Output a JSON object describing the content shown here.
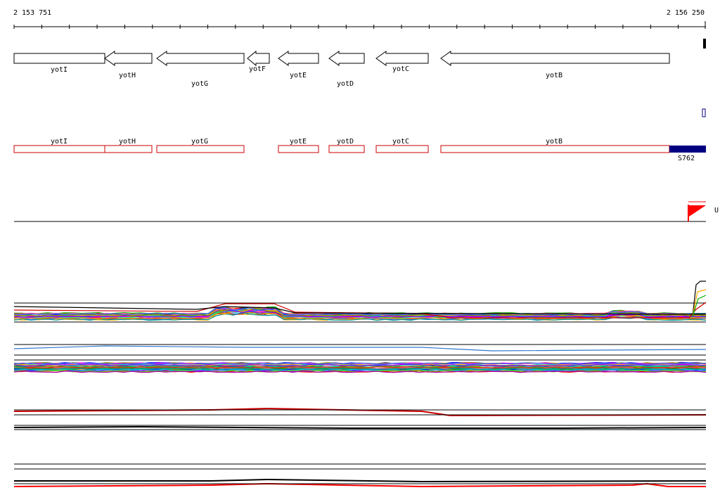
{
  "coords": {
    "start": "2 153 751",
    "end": "2 156 250"
  },
  "genes": [
    {
      "name": "yotI",
      "row": 0
    },
    {
      "name": "yotH",
      "row": 1
    },
    {
      "name": "yotG",
      "row": 2
    },
    {
      "name": "yotF",
      "row": 3
    },
    {
      "name": "yotE",
      "row": 1
    },
    {
      "name": "yotD",
      "row": 2
    },
    {
      "name": "yotC",
      "row": 0
    },
    {
      "name": "yotB",
      "row": 1
    }
  ],
  "cds_boxes": [
    {
      "name": "yotI"
    },
    {
      "name": "yotH"
    },
    {
      "name": "yotG"
    },
    {
      "name": "yotE"
    },
    {
      "name": "yotD"
    },
    {
      "name": "yotC"
    },
    {
      "name": "yotB"
    }
  ],
  "feature_block": {
    "label": "S762",
    "color": "#000080"
  },
  "flag": {
    "label": "U",
    "color": "#ff0000"
  },
  "colors": {
    "gene_border": "#000000",
    "cds_border": "#cc0000",
    "accent_red": "#ff0000"
  }
}
